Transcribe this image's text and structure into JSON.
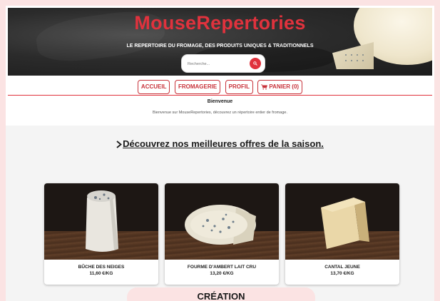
{
  "header": {
    "brand": "MouseRepertories",
    "tagline": "LE REPERTOIRE DU FROMAGE, DES PRODUITS UNIQUES & TRADITIONNELS",
    "search_placeholder": "Recherche...",
    "accent": "#e0323d"
  },
  "nav": {
    "items": [
      {
        "label": "ACCUEIL"
      },
      {
        "label": "FROMAGERIE"
      },
      {
        "label": "PROFIL"
      },
      {
        "label": "PANIER (0)"
      }
    ]
  },
  "welcome": {
    "title": "Bienvenue",
    "text": "Bienvenue sur MouseRepertories, découvrez un répertoire entier de fromage."
  },
  "offers": {
    "heading": "Découvrez nos meilleures offres de la saison."
  },
  "products": [
    {
      "name": "BÛCHE DES NEIGES",
      "price": "11,60 €/KG"
    },
    {
      "name": "FOURME D'AMBERT LAIT CRU",
      "price": "13,20 €/KG"
    },
    {
      "name": "CANTAL JEUNE",
      "price": "13,70 €/KG"
    }
  ],
  "footer": {
    "creation_label": "CRÉATION"
  }
}
